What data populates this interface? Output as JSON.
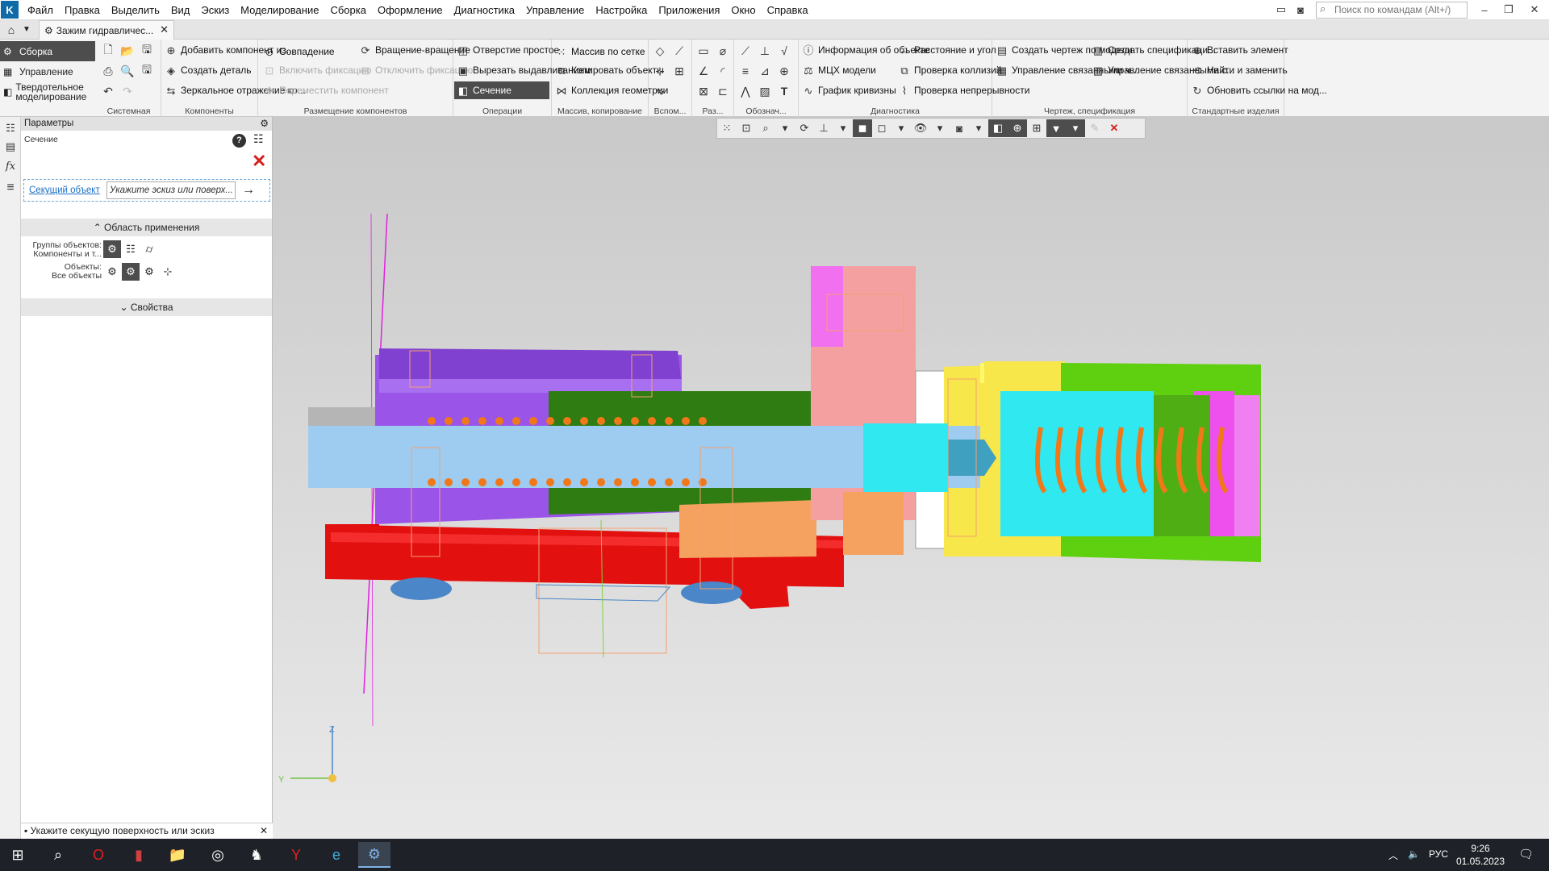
{
  "app": {
    "logo_letter": "K"
  },
  "menu": [
    "Файл",
    "Правка",
    "Выделить",
    "Вид",
    "Эскиз",
    "Моделирование",
    "Сборка",
    "Оформление",
    "Диагностика",
    "Управление",
    "Настройка",
    "Приложения",
    "Окно",
    "Справка"
  ],
  "search": {
    "placeholder": "Поиск по командам (Alt+/)"
  },
  "tab": {
    "title": "Зажим гидравличес..."
  },
  "modes": [
    "Сборка",
    "Управление",
    "Твердотельное моделирование"
  ],
  "ribbon": {
    "groups": [
      "Системная",
      "Компоненты",
      "Размещение компонентов",
      "Операции",
      "Массив, копирование",
      "Вспом...",
      "Раз...",
      "Обознач...",
      "Диагностика",
      "Чертеж, спецификация",
      "Стандартные изделия"
    ],
    "components": [
      "Добавить компонент из...",
      "Создать деталь",
      "Зеркальное отражение ко..."
    ],
    "placement": [
      "Совпадение",
      "Вращение-вращение",
      "Включить фиксацию",
      "Отключить фиксацию",
      "Переместить компонент"
    ],
    "operations": [
      "Отверстие простое",
      "Вырезать выдавливанием",
      "Сечение"
    ],
    "array": [
      "Массив по сетке",
      "Копировать объекты",
      "Коллекция геометрии"
    ],
    "diagnostics": [
      "Информация об объекте",
      "МЦХ модели",
      "График кривизны",
      "Расстояние и угол",
      "Проверка коллизий",
      "Проверка непрерывности"
    ],
    "drawing": [
      "Создать чертеж по модели",
      "Управление связанными ч...",
      "Создать спецификаци...",
      "Управление связанными с..."
    ],
    "standard": [
      "Вставить элемент",
      "Найти и заменить",
      "Обновить ссылки на мод..."
    ]
  },
  "panel": {
    "title": "Параметры",
    "section": "Сечение",
    "obj_link": "Секущий объект",
    "obj_placeholder": "Укажите эскиз или поверх...",
    "area": "Область применения",
    "groups_label": "Группы объектов:",
    "groups_value": "Компоненты и т...",
    "objects_label": "Объекты:",
    "objects_value": "Все объекты",
    "props": "Свойства",
    "hint": "Укажите секущую поверхность или эскиз"
  },
  "axes": {
    "z": "Z",
    "y": "Y"
  },
  "tray": {
    "lang": "РУС",
    "time": "9:26",
    "date": "01.05.2023"
  },
  "colors": {
    "accent": "#4d4d4d",
    "cancel": "#d42020",
    "link": "#1a6fc4"
  }
}
